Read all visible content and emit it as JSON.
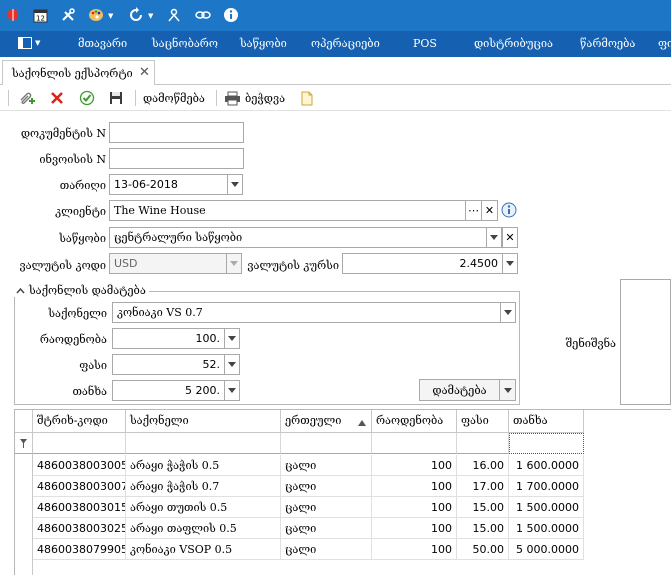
{
  "menu": {
    "items": [
      "მთავარი",
      "საცნობარო",
      "საწყობი",
      "ოპერაციები",
      "POS",
      "დისტრიბუცია",
      "წარმოება",
      "ფი"
    ]
  },
  "tab": {
    "label": "საქონლის ექსპორტი"
  },
  "toolbar": {
    "confirm_label": "დამოწმება",
    "print_label": "ბეჭდვა"
  },
  "form": {
    "document_no_label": "დოკუმენტის N",
    "document_no_value": "",
    "invoice_no_label": "ინვოისის N",
    "invoice_no_value": "",
    "date_label": "თარიღი",
    "date_value": "13-06-2018",
    "client_label": "კლიენტი",
    "client_value": "The Wine House",
    "warehouse_label": "საწყობი",
    "warehouse_value": "ცენტრალური საწყობი",
    "currency_code_label": "ვალუტის კოდი",
    "currency_code_value": "USD",
    "currency_rate_label": "ვალუტის კურსი",
    "currency_rate_value": "2.4500",
    "notes_label": "შენიშვნა"
  },
  "add_group": {
    "title": "საქონლის დამატება",
    "product_label": "საქონელი",
    "product_value": "კონიაკი VS 0.7",
    "quantity_label": "რაოდენობა",
    "quantity_value": "100.",
    "price_label": "ფასი",
    "price_value": "52.",
    "amount_label": "თანხა",
    "amount_value": "5 200.",
    "add_button_label": "დამატება"
  },
  "grid": {
    "columns": [
      "შტრიხ-კოდი",
      "საქონელი",
      "ერთეული",
      "რაოდენობა",
      "ფასი",
      "თანხა"
    ],
    "rows": [
      [
        "4860038003005",
        "არაყი ჭაჭის 0.5",
        "ცალი",
        "100",
        "16.00",
        "1 600.0000"
      ],
      [
        "4860038003007",
        "არაყი ჭაჭის 0.7",
        "ცალი",
        "100",
        "17.00",
        "1 700.0000"
      ],
      [
        "4860038003015",
        "არაყი თუთის 0.5",
        "ცალი",
        "100",
        "15.00",
        "1 500.0000"
      ],
      [
        "4860038003025",
        "არაყი თაფლის 0.5",
        "ცალი",
        "100",
        "15.00",
        "1 500.0000"
      ],
      [
        "4860038079905",
        "კონიაკი VSOP 0.5",
        "ცალი",
        "100",
        "50.00",
        "5 000.0000"
      ]
    ]
  },
  "colors": {
    "topbar": "#1d77c6",
    "menubar": "#1560b0",
    "delete_red": "#d9261c",
    "confirm_green": "#3a9a2a"
  }
}
